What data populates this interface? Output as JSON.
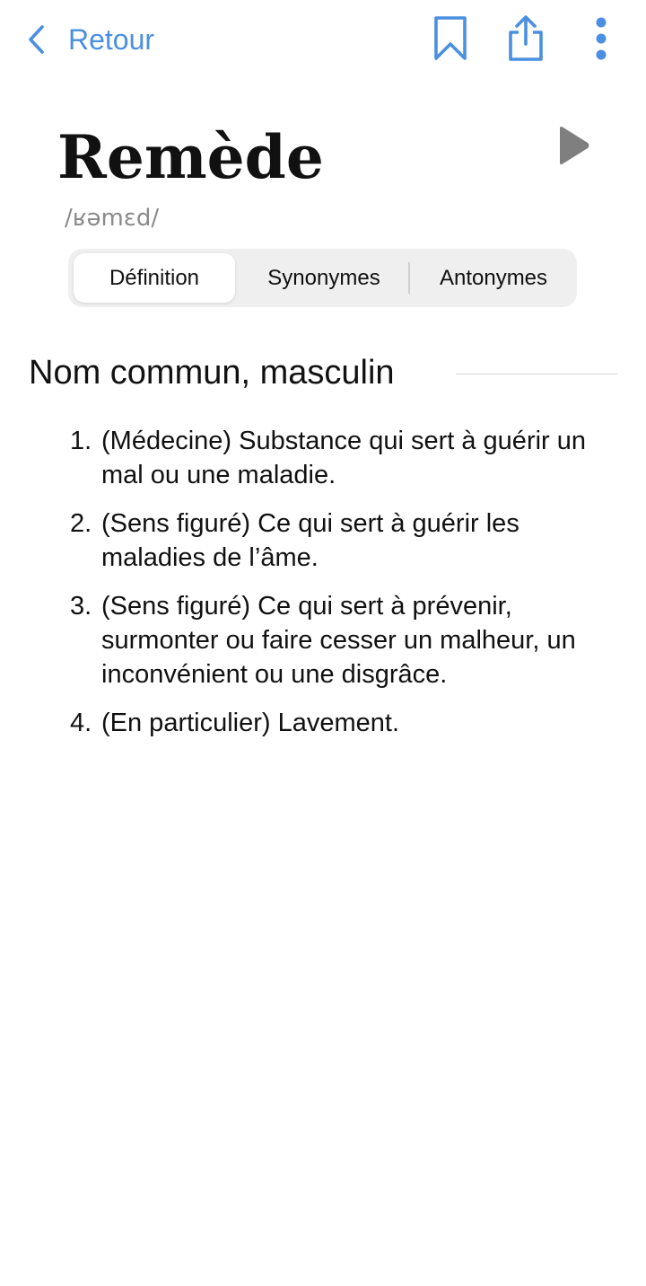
{
  "topbar": {
    "back_label": "Retour",
    "icons": {
      "back": "chevron-left-icon",
      "bookmark": "bookmark-icon",
      "share": "share-icon",
      "more": "more-vertical-icon"
    },
    "accent_color": "#4a8fe0"
  },
  "entry": {
    "word": "Remède",
    "phonetic": "/ʁəmɛd/",
    "play_icon": "play-icon"
  },
  "tabs": [
    {
      "label": "Définition",
      "active": true
    },
    {
      "label": "Synonymes",
      "active": false
    },
    {
      "label": "Antonymes",
      "active": false
    }
  ],
  "section": {
    "heading": "Nom commun, masculin",
    "definitions": [
      {
        "num": "1.",
        "text": "(Médecine) Substance qui sert à guérir un mal ou une maladie."
      },
      {
        "num": "2.",
        "text": "(Sens figuré) Ce qui sert à guérir les maladies de l’âme."
      },
      {
        "num": "3.",
        "text": "(Sens figuré) Ce qui sert à prévenir, surmonter ou faire cesser un malheur, un inconvénient ou une disgrâce."
      },
      {
        "num": "4.",
        "text": "(En particulier) Lavement."
      }
    ]
  }
}
